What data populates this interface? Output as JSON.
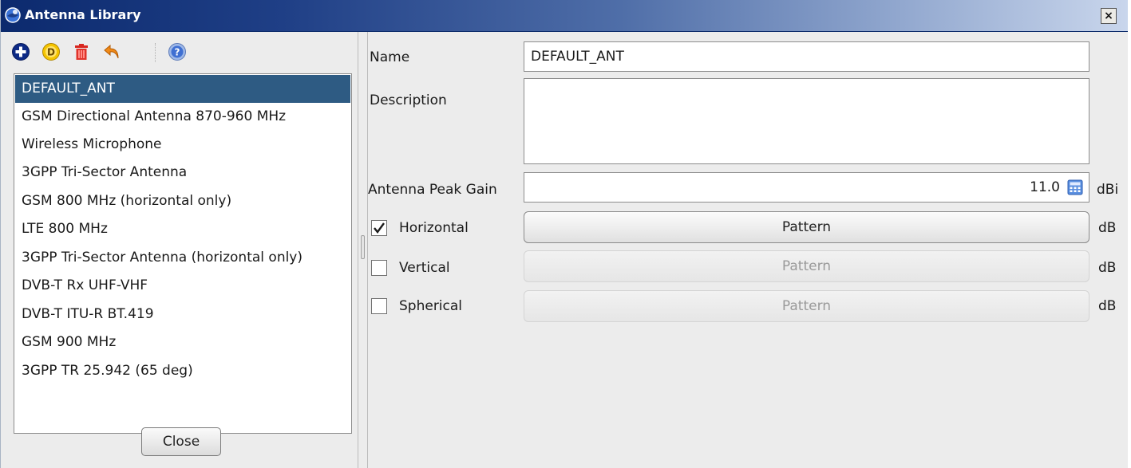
{
  "window": {
    "title": "Antenna Library",
    "close_glyph": "×",
    "title_icon": "globe-app-icon"
  },
  "toolbar": {
    "icons": [
      "add-icon",
      "default-icon",
      "delete-icon",
      "undo-icon",
      "help-icon"
    ]
  },
  "antenna_list": {
    "selected_index": 0,
    "items": [
      "DEFAULT_ANT",
      "GSM Directional Antenna 870-960 MHz",
      "Wireless Microphone",
      "3GPP Tri-Sector Antenna",
      "GSM 800 MHz (horizontal only)",
      "LTE 800 MHz",
      "3GPP Tri-Sector Antenna (horizontal only)",
      "DVB-T Rx UHF-VHF",
      "DVB-T ITU-R BT.419",
      "GSM 900 MHz",
      "3GPP TR 25.942 (65 deg)"
    ]
  },
  "close_button": {
    "label": "Close"
  },
  "form": {
    "name_label": "Name",
    "name_value": "DEFAULT_ANT",
    "description_label": "Description",
    "description_value": "",
    "gain_label": "Antenna Peak Gain",
    "gain_value": "11.0",
    "gain_unit": "dBi",
    "patterns": [
      {
        "label": "Horizontal",
        "checked": true,
        "button_label": "Pattern",
        "unit": "dB",
        "enabled": true
      },
      {
        "label": "Vertical",
        "checked": false,
        "button_label": "Pattern",
        "unit": "dB",
        "enabled": false
      },
      {
        "label": "Spherical",
        "checked": false,
        "button_label": "Pattern",
        "unit": "dB",
        "enabled": false
      }
    ]
  },
  "colors": {
    "selection": "#2e5b83",
    "titlebar_start": "#0c2a6e",
    "titlebar_end": "#c9d6ec"
  }
}
